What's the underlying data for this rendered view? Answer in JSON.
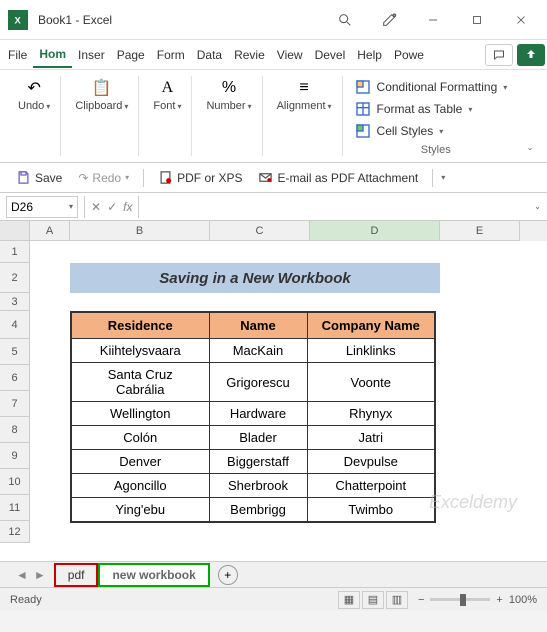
{
  "window": {
    "title": "Book1 - Excel"
  },
  "menu": {
    "items": [
      "File",
      "Hom",
      "Inser",
      "Page",
      "Form",
      "Data",
      "Revie",
      "View",
      "Devel",
      "Help",
      "Powe"
    ],
    "active_index": 1
  },
  "ribbon": {
    "undo": "Undo",
    "clipboard": "Clipboard",
    "font": "Font",
    "number": "Number",
    "alignment": "Alignment",
    "conditional": "Conditional Formatting",
    "format_table": "Format as Table",
    "cell_styles": "Cell Styles",
    "styles_label": "Styles"
  },
  "qat": {
    "save": "Save",
    "redo": "Redo",
    "pdf_xps": "PDF or XPS",
    "email_pdf": "E-mail as PDF Attachment"
  },
  "formula_bar": {
    "name_box": "D26",
    "fx": "fx"
  },
  "columns": [
    "A",
    "B",
    "C",
    "D",
    "E"
  ],
  "rows": [
    "1",
    "2",
    "3",
    "4",
    "5",
    "6",
    "7",
    "8",
    "9",
    "10",
    "11",
    "12"
  ],
  "sheet_title": "Saving in a New Workbook",
  "table": {
    "headers": [
      "Residence",
      "Name",
      "Company Name"
    ],
    "rows": [
      [
        "Kiihtelysvaara",
        "MacKain",
        "Linklinks"
      ],
      [
        "Santa Cruz Cabrália",
        "Grigorescu",
        "Voonte"
      ],
      [
        "Wellington",
        "Hardware",
        "Rhynyx"
      ],
      [
        "Colón",
        "Blader",
        "Jatri"
      ],
      [
        "Denver",
        "Biggerstaff",
        "Devpulse"
      ],
      [
        "Agoncillo",
        "Sherbrook",
        "Chatterpoint"
      ],
      [
        "Ying'ebu",
        "Bembrigg",
        "Twimbo"
      ]
    ]
  },
  "tabs": {
    "pdf": "pdf",
    "active": "new workbook"
  },
  "status": {
    "ready": "Ready",
    "zoom": "100%"
  },
  "watermark": "Exceldemy"
}
